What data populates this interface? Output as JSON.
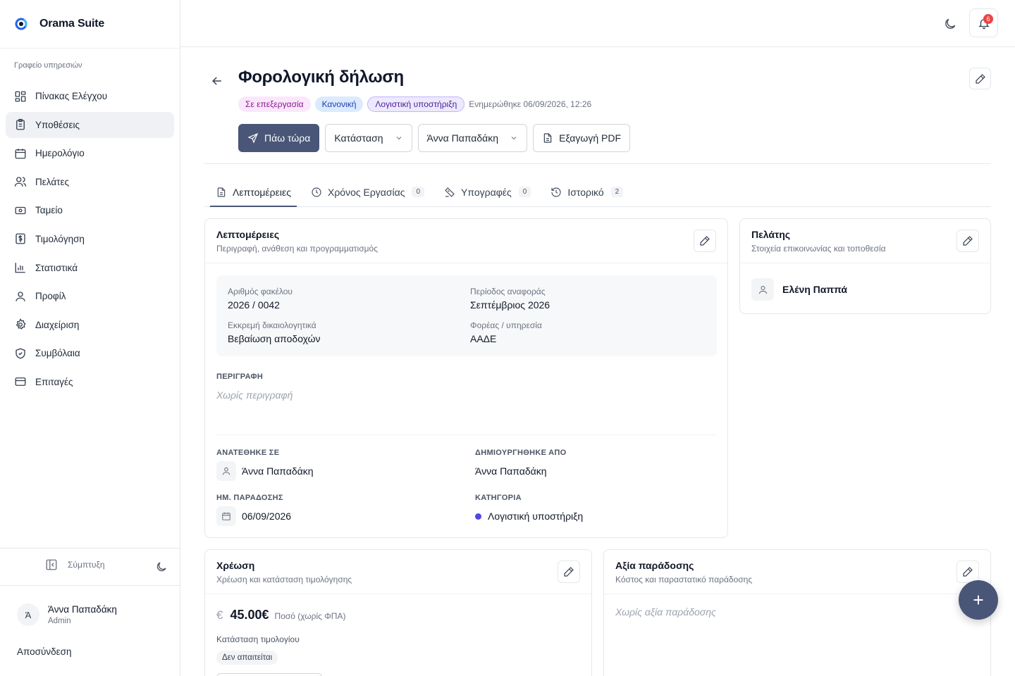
{
  "app": {
    "name": "Orama Suite"
  },
  "sidebar": {
    "section_label": "Γραφείο υπηρεσιών",
    "items": [
      {
        "label": "Πίνακας Ελέγχου",
        "icon": "dashboard-icon"
      },
      {
        "label": "Υποθέσεις",
        "icon": "clipboard-icon",
        "active": true
      },
      {
        "label": "Ημερολόγιο",
        "icon": "calendar-icon"
      },
      {
        "label": "Πελάτες",
        "icon": "users-icon"
      },
      {
        "label": "Ταμείο",
        "icon": "cash-icon"
      },
      {
        "label": "Τιμολόγηση",
        "icon": "invoice-icon"
      },
      {
        "label": "Στατιστικά",
        "icon": "bar-chart-icon"
      },
      {
        "label": "Προφίλ",
        "icon": "user-icon"
      },
      {
        "label": "Διαχείριση",
        "icon": "gear-icon"
      },
      {
        "label": "Συμβόλαια",
        "icon": "shield-icon"
      },
      {
        "label": "Επιταγές",
        "icon": "credit-card-icon"
      }
    ],
    "collapse_label": "Σύμπτυξη",
    "user": {
      "initial": "Ά",
      "name": "Άννα Παπαδάκη",
      "role": "Admin"
    },
    "logout_label": "Αποσύνδεση"
  },
  "topbar": {
    "notifications_count": "6"
  },
  "header": {
    "title": "Φορολογική δήλωση",
    "badges": {
      "status": "Σε επεξεργασία",
      "priority": "Κανονική",
      "category": "Λογιστική υποστήριξη"
    },
    "updated": "Ενημερώθηκε 06/09/2026, 12:26",
    "actions": {
      "go_now": "Πάω τώρα",
      "status": "Κατάσταση",
      "assignee": "Άννα Παπαδάκη",
      "export_pdf": "Εξαγωγή PDF"
    }
  },
  "tabs": [
    {
      "label": "Λεπτομέρειες",
      "icon": "document-icon",
      "active": true
    },
    {
      "label": "Χρόνος Εργασίας",
      "icon": "clock-icon",
      "count": "0"
    },
    {
      "label": "Υπογραφές",
      "icon": "signature-icon",
      "count": "0"
    },
    {
      "label": "Ιστορικό",
      "icon": "history-icon",
      "count": "2"
    }
  ],
  "details": {
    "title": "Λεπτομέρειες",
    "subtitle": "Περιγραφή, ανάθεση και προγραμματισμός",
    "fields": {
      "file_number_label": "Αριθμός φακέλου",
      "file_number": "2026 / 0042",
      "period_label": "Περίοδος αναφοράς",
      "period": "Σεπτέμβριος 2026",
      "pending_docs_label": "Εκκρεμή δικαιολογητικά",
      "pending_docs": "Βεβαίωση αποδοχών",
      "agency_label": "Φορέας / υπηρεσία",
      "agency": "ΑΑΔΕ"
    },
    "description_label": "ΠΕΡΙΓΡΑΦΗ",
    "description_empty": "Χωρίς περιγραφή",
    "assigned_label": "ΑΝΑΤΕΘΗΚΕ ΣΕ",
    "assigned_to": "Άννα Παπαδάκη",
    "created_by_label": "ΔΗΜΙΟΥΡΓΗΘΗΚΕ ΑΠΟ",
    "created_by": "Άννα Παπαδάκη",
    "due_label": "ΗΜ. ΠΑΡΑΔΟΣΗΣ",
    "due_date": "06/09/2026",
    "category_label": "ΚΑΤΗΓΟΡΙΑ",
    "category": "Λογιστική υποστήριξη",
    "category_color": "#4f46e5"
  },
  "client": {
    "title": "Πελάτης",
    "subtitle": "Στοιχεία επικοινωνίας και τοποθεσία",
    "name": "Ελένη Παππά"
  },
  "charge": {
    "title": "Χρέωση",
    "subtitle": "Χρέωση και κατάσταση τιμολόγησης",
    "currency_symbol": "€",
    "amount": "45.00€",
    "amount_note": "Ποσό (χωρίς ΦΠΑ)",
    "invoice_status_label": "Κατάσταση τιμολογίου",
    "invoice_status": "Δεν απαιτείται"
  },
  "delivery": {
    "title": "Αξία παράδοσης",
    "subtitle": "Κόστος και παραστατικό παράδοσης",
    "empty": "Χωρίς αξία παράδοσης"
  },
  "colors": {
    "primary": "#4a5677",
    "badge_red": "#ef4444"
  }
}
